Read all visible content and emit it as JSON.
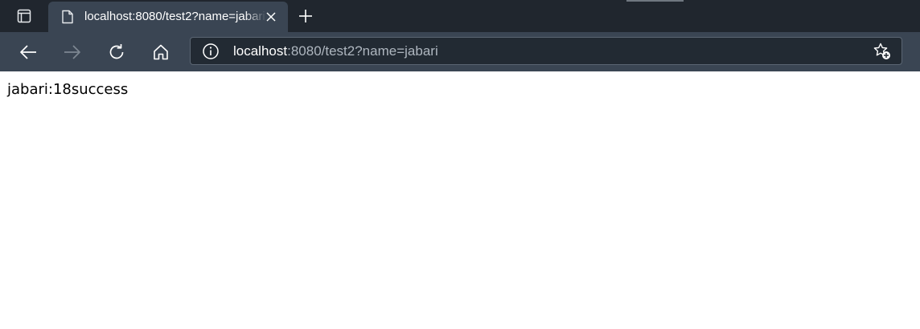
{
  "window": {
    "tab": {
      "title": "localhost:8080/test2?name=jabari",
      "favicon": "page-icon"
    },
    "icons": {
      "tab_actions": "tab-actions-icon",
      "close": "close-icon",
      "new_tab": "plus-icon"
    }
  },
  "toolbar": {
    "back": "back-arrow-icon",
    "forward": "forward-arrow-icon",
    "refresh": "refresh-icon",
    "home": "home-icon",
    "address": {
      "host": "localhost",
      "rest": ":8080/test2?name=jabari",
      "site_info_icon": "info-icon"
    },
    "favorite": "add-favorite-icon"
  },
  "page": {
    "text": "jabari:18success"
  },
  "colors": {
    "tabstrip": "#20262e",
    "toolbar": "#3a4553",
    "omnibox": "#222a33",
    "url_dim": "#aeb6bf"
  }
}
